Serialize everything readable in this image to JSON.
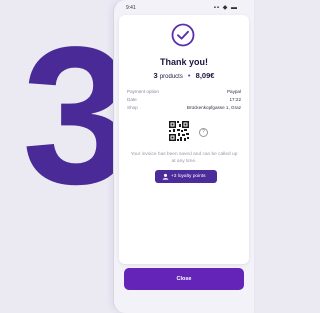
{
  "hero": {
    "number": "3"
  },
  "status_bar": {
    "time": "9:41",
    "icons": "▪▪ ◆ ▬"
  },
  "receipt": {
    "title": "Thank you!",
    "count": "3",
    "count_label": "products",
    "separator": "•",
    "total": "8,09€",
    "details": [
      {
        "key": "Payment option",
        "value": "Paypal"
      },
      {
        "key": "Date",
        "value": "17:22"
      },
      {
        "key": "Shop",
        "value": "Brückenkopfgasse 1, Graz"
      }
    ],
    "help_icon": "?",
    "invoice_note": "Your invoice has been saved and can be called up at any time.",
    "loyalty_label": "+3 loyalty points"
  },
  "actions": {
    "close_label": "Close"
  },
  "colors": {
    "brand": "#4a2a96",
    "accent": "#6424b8",
    "background": "#ebe9f2"
  }
}
